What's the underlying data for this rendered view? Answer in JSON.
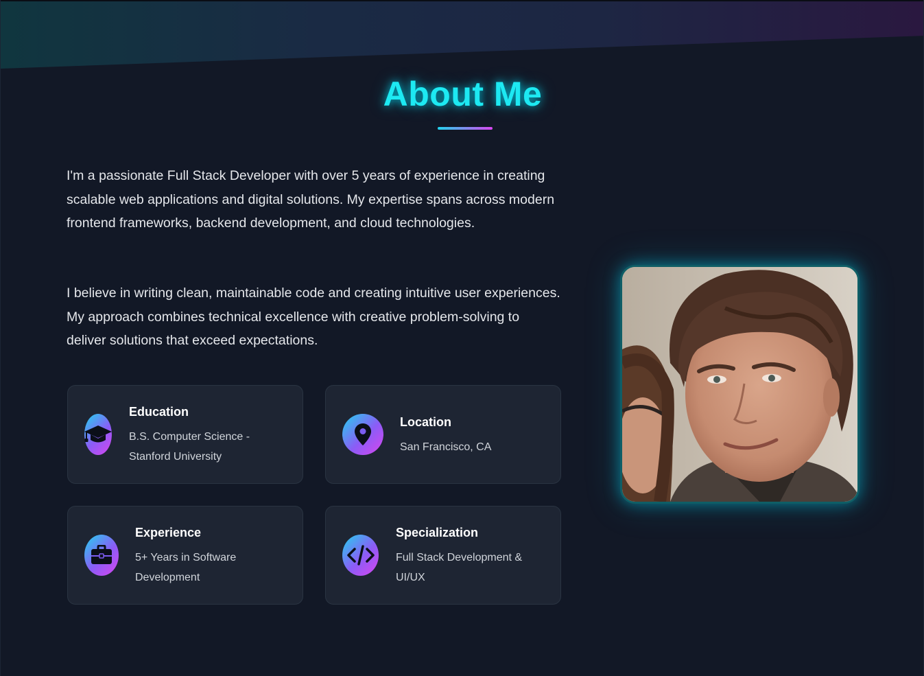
{
  "section": {
    "title": "About Me"
  },
  "intro": {
    "paragraph1": "I'm a passionate Full Stack Developer with over 5 years of experience in creating scalable web applications and digital solutions. My expertise spans across modern frontend frameworks, backend development, and cloud technologies.",
    "paragraph2": "I believe in writing clean, maintainable code and creating intuitive user experiences. My approach combines technical excellence with creative problem-solving to deliver solutions that exceed expectations."
  },
  "cards": [
    {
      "icon": "graduation-cap-icon",
      "title": "Education",
      "text": "B.S. Computer Science - Stanford University"
    },
    {
      "icon": "map-pin-icon",
      "title": "Location",
      "text": "San Francisco, CA"
    },
    {
      "icon": "briefcase-icon",
      "title": "Experience",
      "text": "5+ Years in Software Development"
    },
    {
      "icon": "code-icon",
      "title": "Specialization",
      "text": "Full Stack Development & UI/UX"
    }
  ],
  "colors": {
    "accent_cyan": "#1de9f2",
    "accent_magenta": "#d946ef",
    "background": "#121826",
    "card_background": "#1e2533"
  }
}
